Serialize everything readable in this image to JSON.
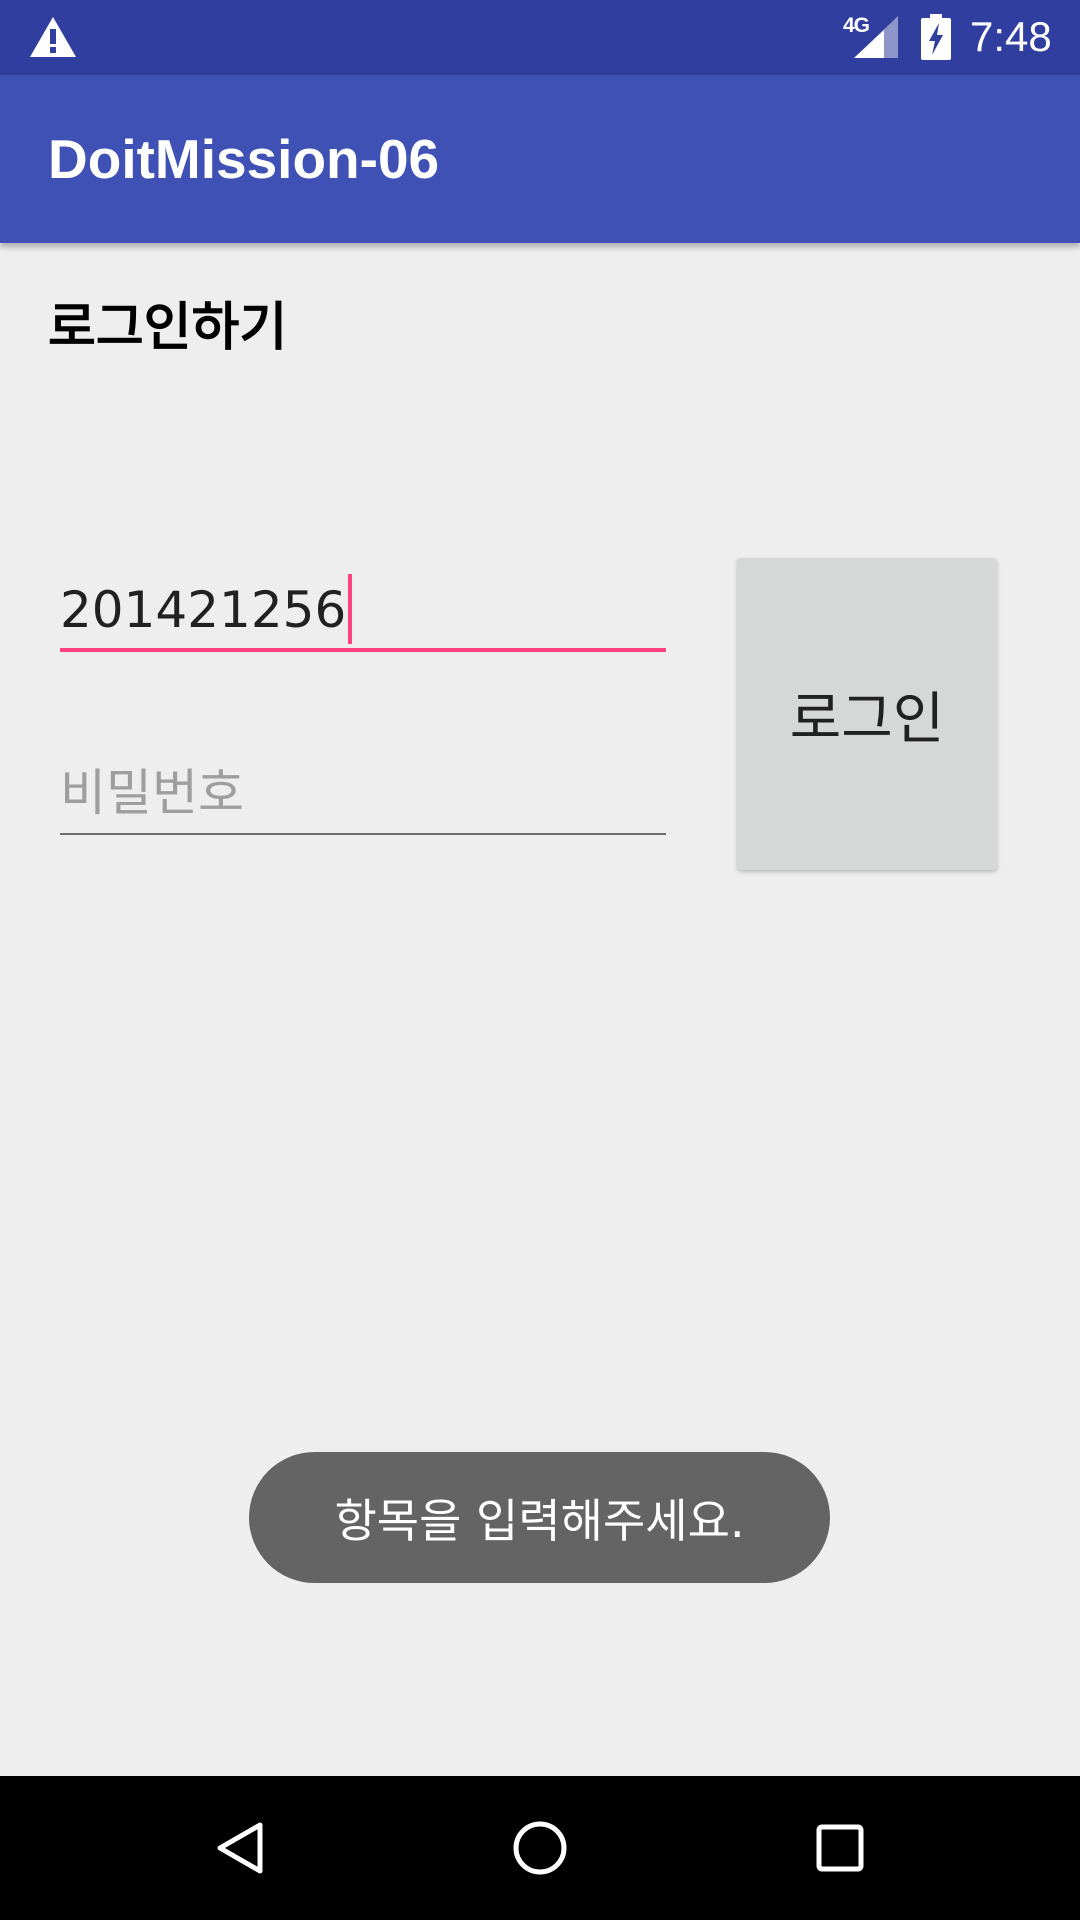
{
  "status_bar": {
    "network": "4G",
    "time": "7:48",
    "icons": [
      "warning-icon",
      "signal-icon",
      "battery-charging-icon"
    ]
  },
  "app_bar": {
    "title": "DoitMission-06"
  },
  "content": {
    "heading": "로그인하기",
    "id_field": {
      "value": "201421256",
      "placeholder": ""
    },
    "password_field": {
      "value": "",
      "placeholder": "비밀번호"
    },
    "login_button_label": "로그인"
  },
  "toast": {
    "message": "항목을 입력해주세요."
  },
  "nav_bar": {
    "icons": [
      "back-icon",
      "home-icon",
      "recents-icon"
    ]
  },
  "colors": {
    "status_bar": "#303f9f",
    "app_bar": "#3f51b5",
    "accent": "#ff4081",
    "background": "#eeeeee",
    "button": "#d6d7d7",
    "toast": "#646464"
  }
}
